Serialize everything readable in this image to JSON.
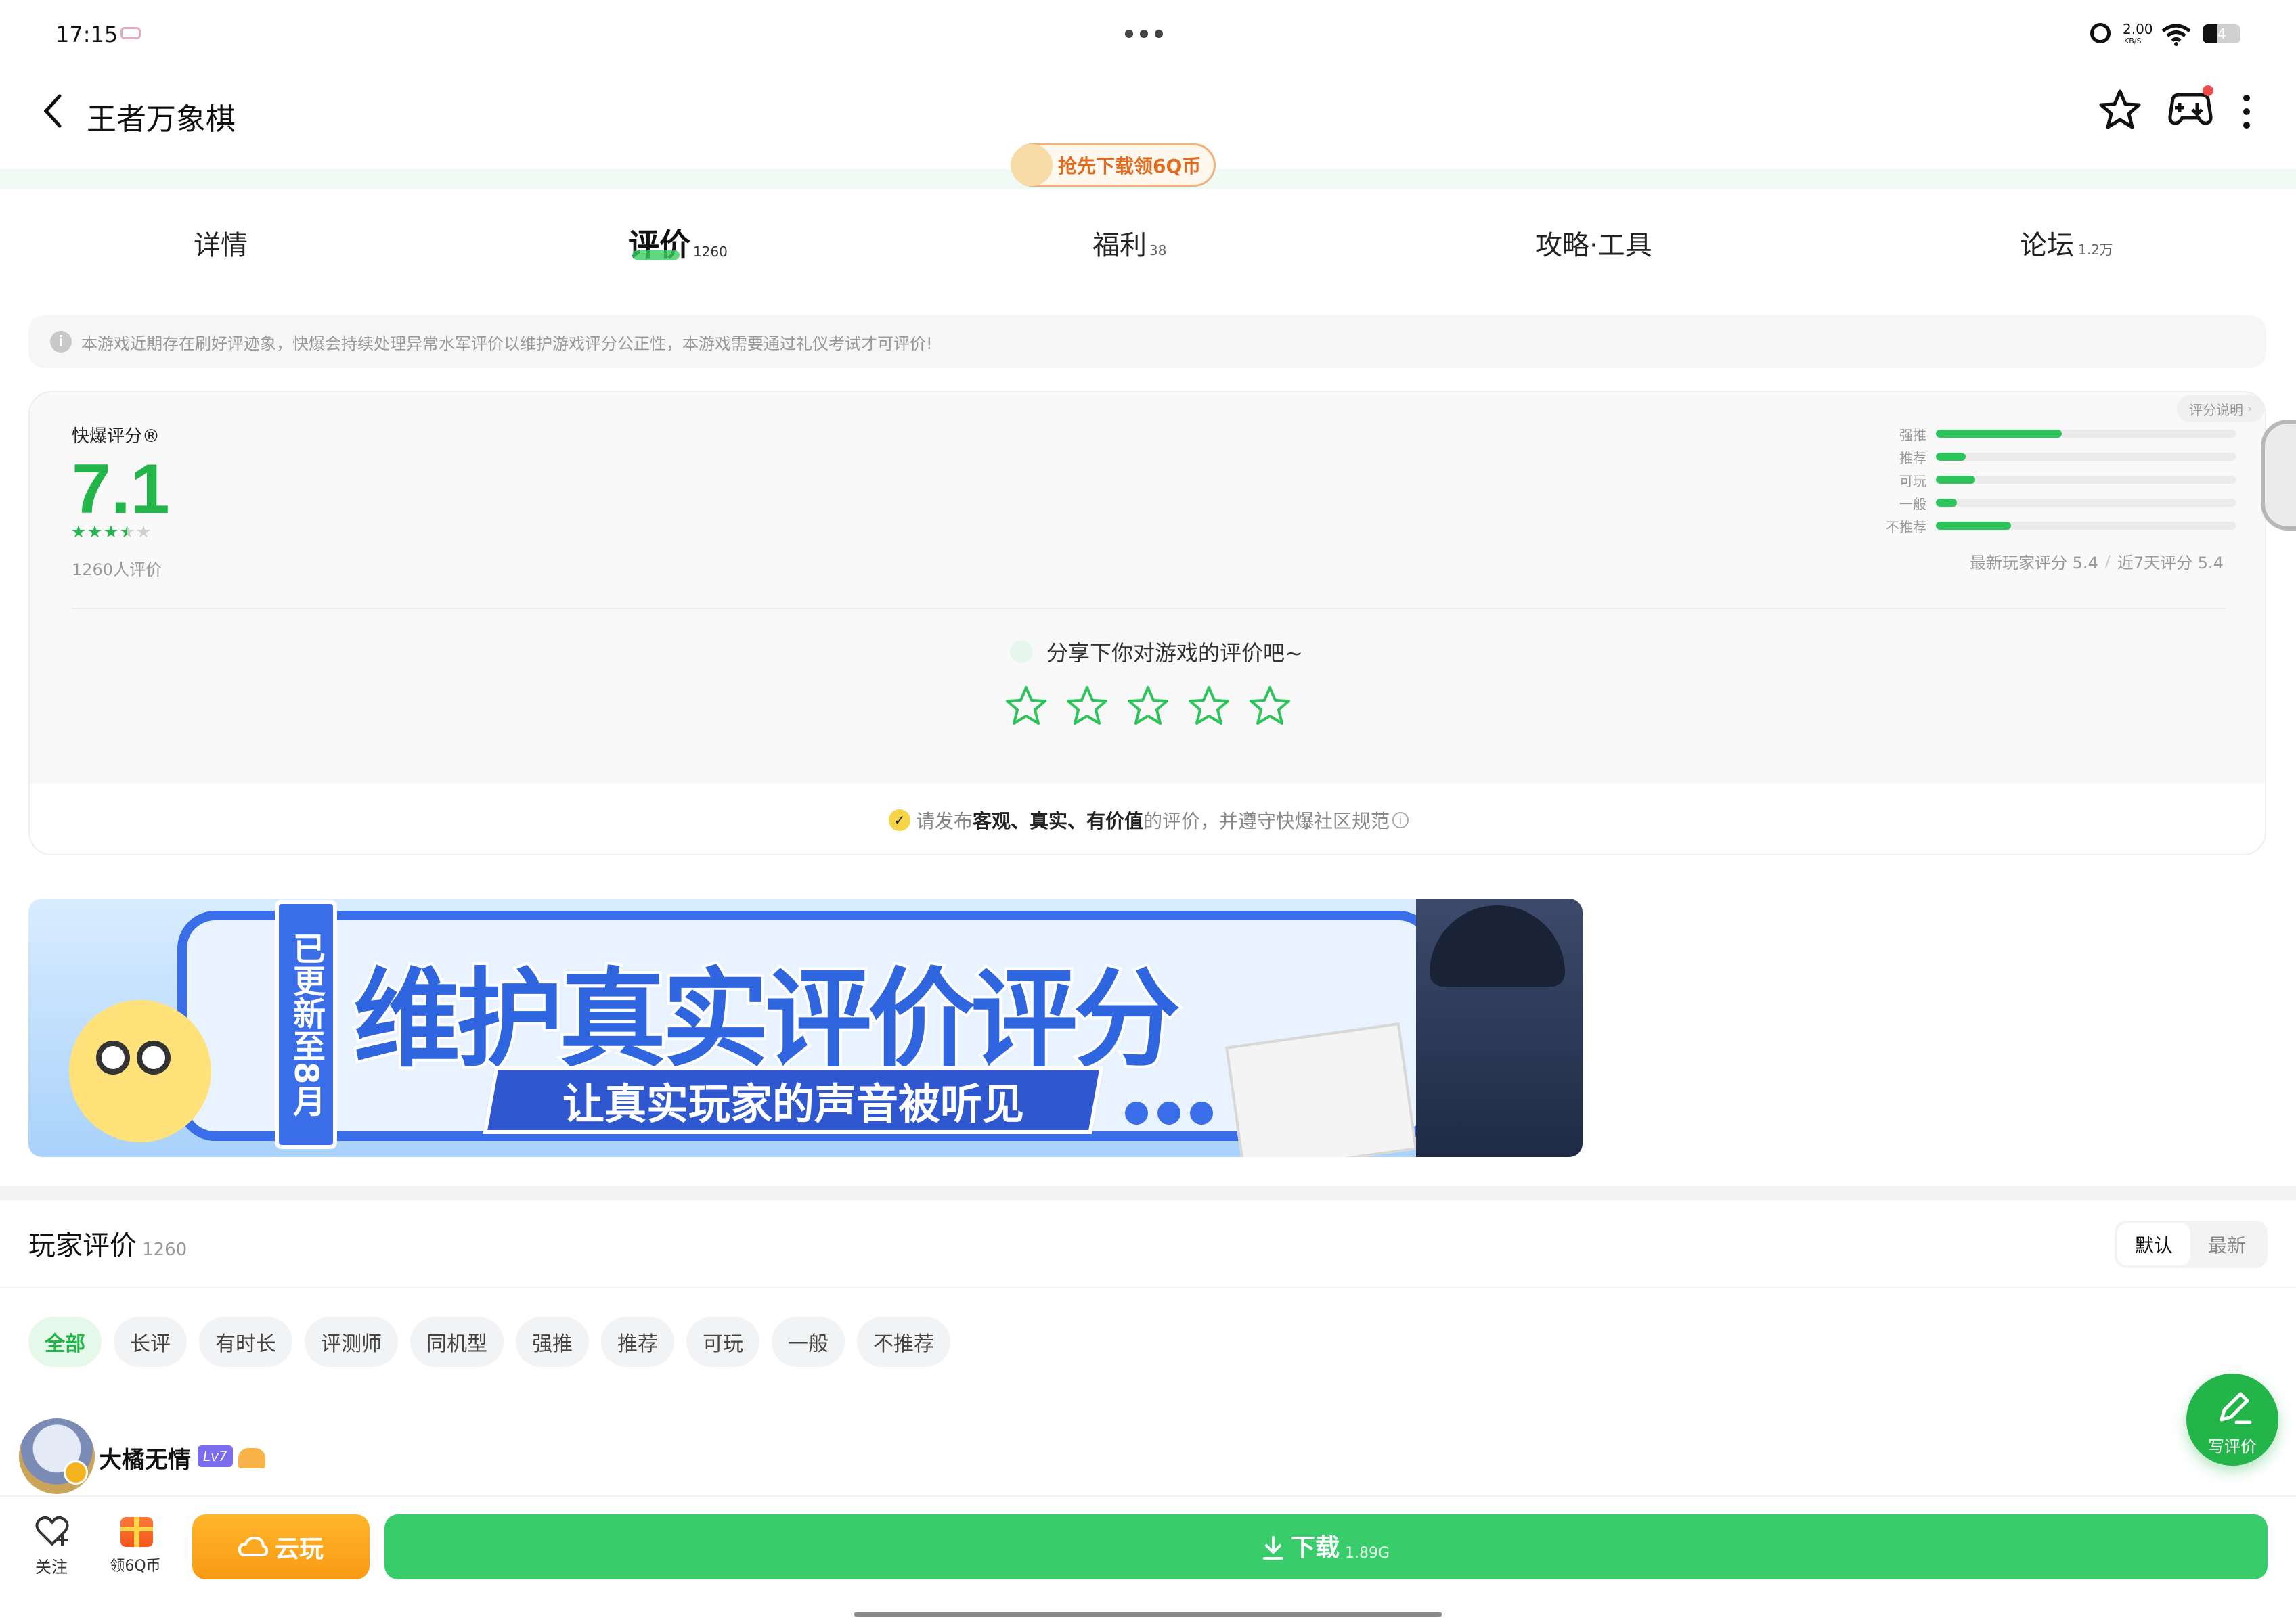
{
  "status_bar": {
    "time": "17:15",
    "net_speed_top": "2.00",
    "net_speed_bottom": "KB/S",
    "battery": "4"
  },
  "header": {
    "title": "王者万象棋"
  },
  "promo": {
    "label": "抢先下载领6Q币"
  },
  "tabs": [
    {
      "label": "详情",
      "count": ""
    },
    {
      "label": "评价",
      "count": "1260"
    },
    {
      "label": "福利",
      "count": "38"
    },
    {
      "label": "攻略·工具",
      "count": ""
    },
    {
      "label": "论坛",
      "count": "1.2万"
    }
  ],
  "notice": {
    "text": "本游戏近期存在刷好评迹象，快爆会持续处理异常水军评价以维护游戏评分公正性，本游戏需要通过礼仪考试才可评价!"
  },
  "rating": {
    "title": "快爆评分®",
    "score": "7.1",
    "stars": 3.5,
    "count_text": "1260人评价",
    "explain": "评分说明",
    "distribution": [
      {
        "label": "强推",
        "fraction": 0.42
      },
      {
        "label": "推荐",
        "fraction": 0.1
      },
      {
        "label": "可玩",
        "fraction": 0.13
      },
      {
        "label": "一般",
        "fraction": 0.07
      },
      {
        "label": "不推荐",
        "fraction": 0.25
      }
    ],
    "recent": "最新玩家评分 5.4",
    "divider": "/",
    "seven_day": "近7天评分 5.4",
    "share_prompt": "分享下你对游戏的评价吧~",
    "rule_pre": "请发布",
    "rule_bold": "客观、真实、有价值",
    "rule_post": "的评价，并遵守快爆社区规范"
  },
  "banner": {
    "side_text": "已更新至8月",
    "headline": "维护真实评价评分",
    "subline": "让真实玩家的声音被听见"
  },
  "reviews": {
    "title": "玩家评价",
    "count": "1260",
    "sort": [
      "默认",
      "最新"
    ],
    "filters": [
      "全部",
      "长评",
      "有时长",
      "评测师",
      "同机型",
      "强推",
      "推荐",
      "可玩",
      "一般",
      "不推荐"
    ],
    "first_user": {
      "name": "大橘无情",
      "level": "Lv7"
    }
  },
  "write_review": {
    "label": "写评价"
  },
  "bottom_bar": {
    "follow": "关注",
    "coins": "领6Q币",
    "cloud": "云玩",
    "download": "下载",
    "size": "1.89G"
  },
  "colors": {
    "brand_green": "#23b44a",
    "cloud_orange": "#fba41c",
    "download_green": "#38cc6a"
  }
}
